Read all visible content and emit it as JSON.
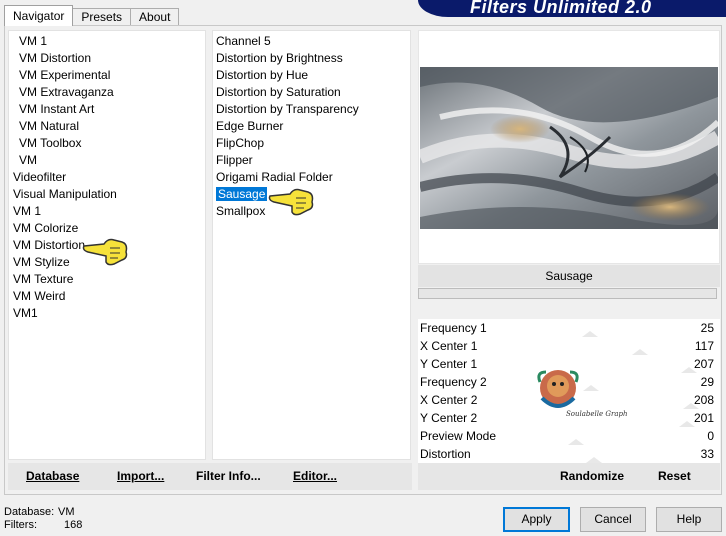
{
  "tabs": [
    {
      "label": "Navigator",
      "active": true
    },
    {
      "label": "Presets",
      "active": false
    },
    {
      "label": "About",
      "active": false
    }
  ],
  "banner": {
    "title": "Filters Unlimited 2.0",
    "color": "#0a1a6a"
  },
  "categories": [
    "VM 1",
    "VM Distortion",
    "VM Experimental",
    "VM Extravaganza",
    "VM Instant Art",
    "VM Natural",
    "VM Toolbox",
    "VM",
    "Videofilter",
    "Visual Manipulation",
    "VM 1",
    "VM Colorize",
    "VM Distortion",
    "VM Stylize",
    "VM Texture",
    "VM Weird",
    "VM1"
  ],
  "filters": [
    "Channel 5",
    "Distortion by Brightness",
    "Distortion by Hue",
    "Distortion by Saturation",
    "Distortion by Transparency",
    "Edge Burner",
    "FlipChop",
    "Flipper",
    "Origami Radial Folder",
    "Sausage",
    "Smallpox"
  ],
  "selected_filter_index": 9,
  "selected_filter_name": "Sausage",
  "params": [
    {
      "label": "Frequency 1",
      "value": "25",
      "level": 0.1
    },
    {
      "label": "X Center 1",
      "value": "117",
      "level": 0.46
    },
    {
      "label": "Y Center 1",
      "value": "207",
      "level": 0.81
    },
    {
      "label": "Frequency 2",
      "value": "29",
      "level": 0.11
    },
    {
      "label": "X Center 2",
      "value": "208",
      "level": 0.82
    },
    {
      "label": "Y Center 2",
      "value": "201",
      "level": 0.79
    },
    {
      "label": "Preview Mode",
      "value": "0",
      "level": 0
    },
    {
      "label": "Distortion",
      "value": "33",
      "level": 0.13
    }
  ],
  "left_buttons": {
    "database": "Database",
    "import": "Import...",
    "filter_info": "Filter Info...",
    "editor": "Editor..."
  },
  "right_buttons": {
    "randomize": "Randomize",
    "reset": "Reset"
  },
  "status": {
    "database_label": "Database:",
    "database_value": "VM",
    "filters_label": "Filters:",
    "filters_value": "168"
  },
  "dialog_buttons": {
    "apply": "Apply",
    "cancel": "Cancel",
    "help": "Help"
  },
  "watermark_text": "Soulabelle Graph",
  "colors": {
    "selection": "#0078d7",
    "accent_border": "#0078d7"
  }
}
